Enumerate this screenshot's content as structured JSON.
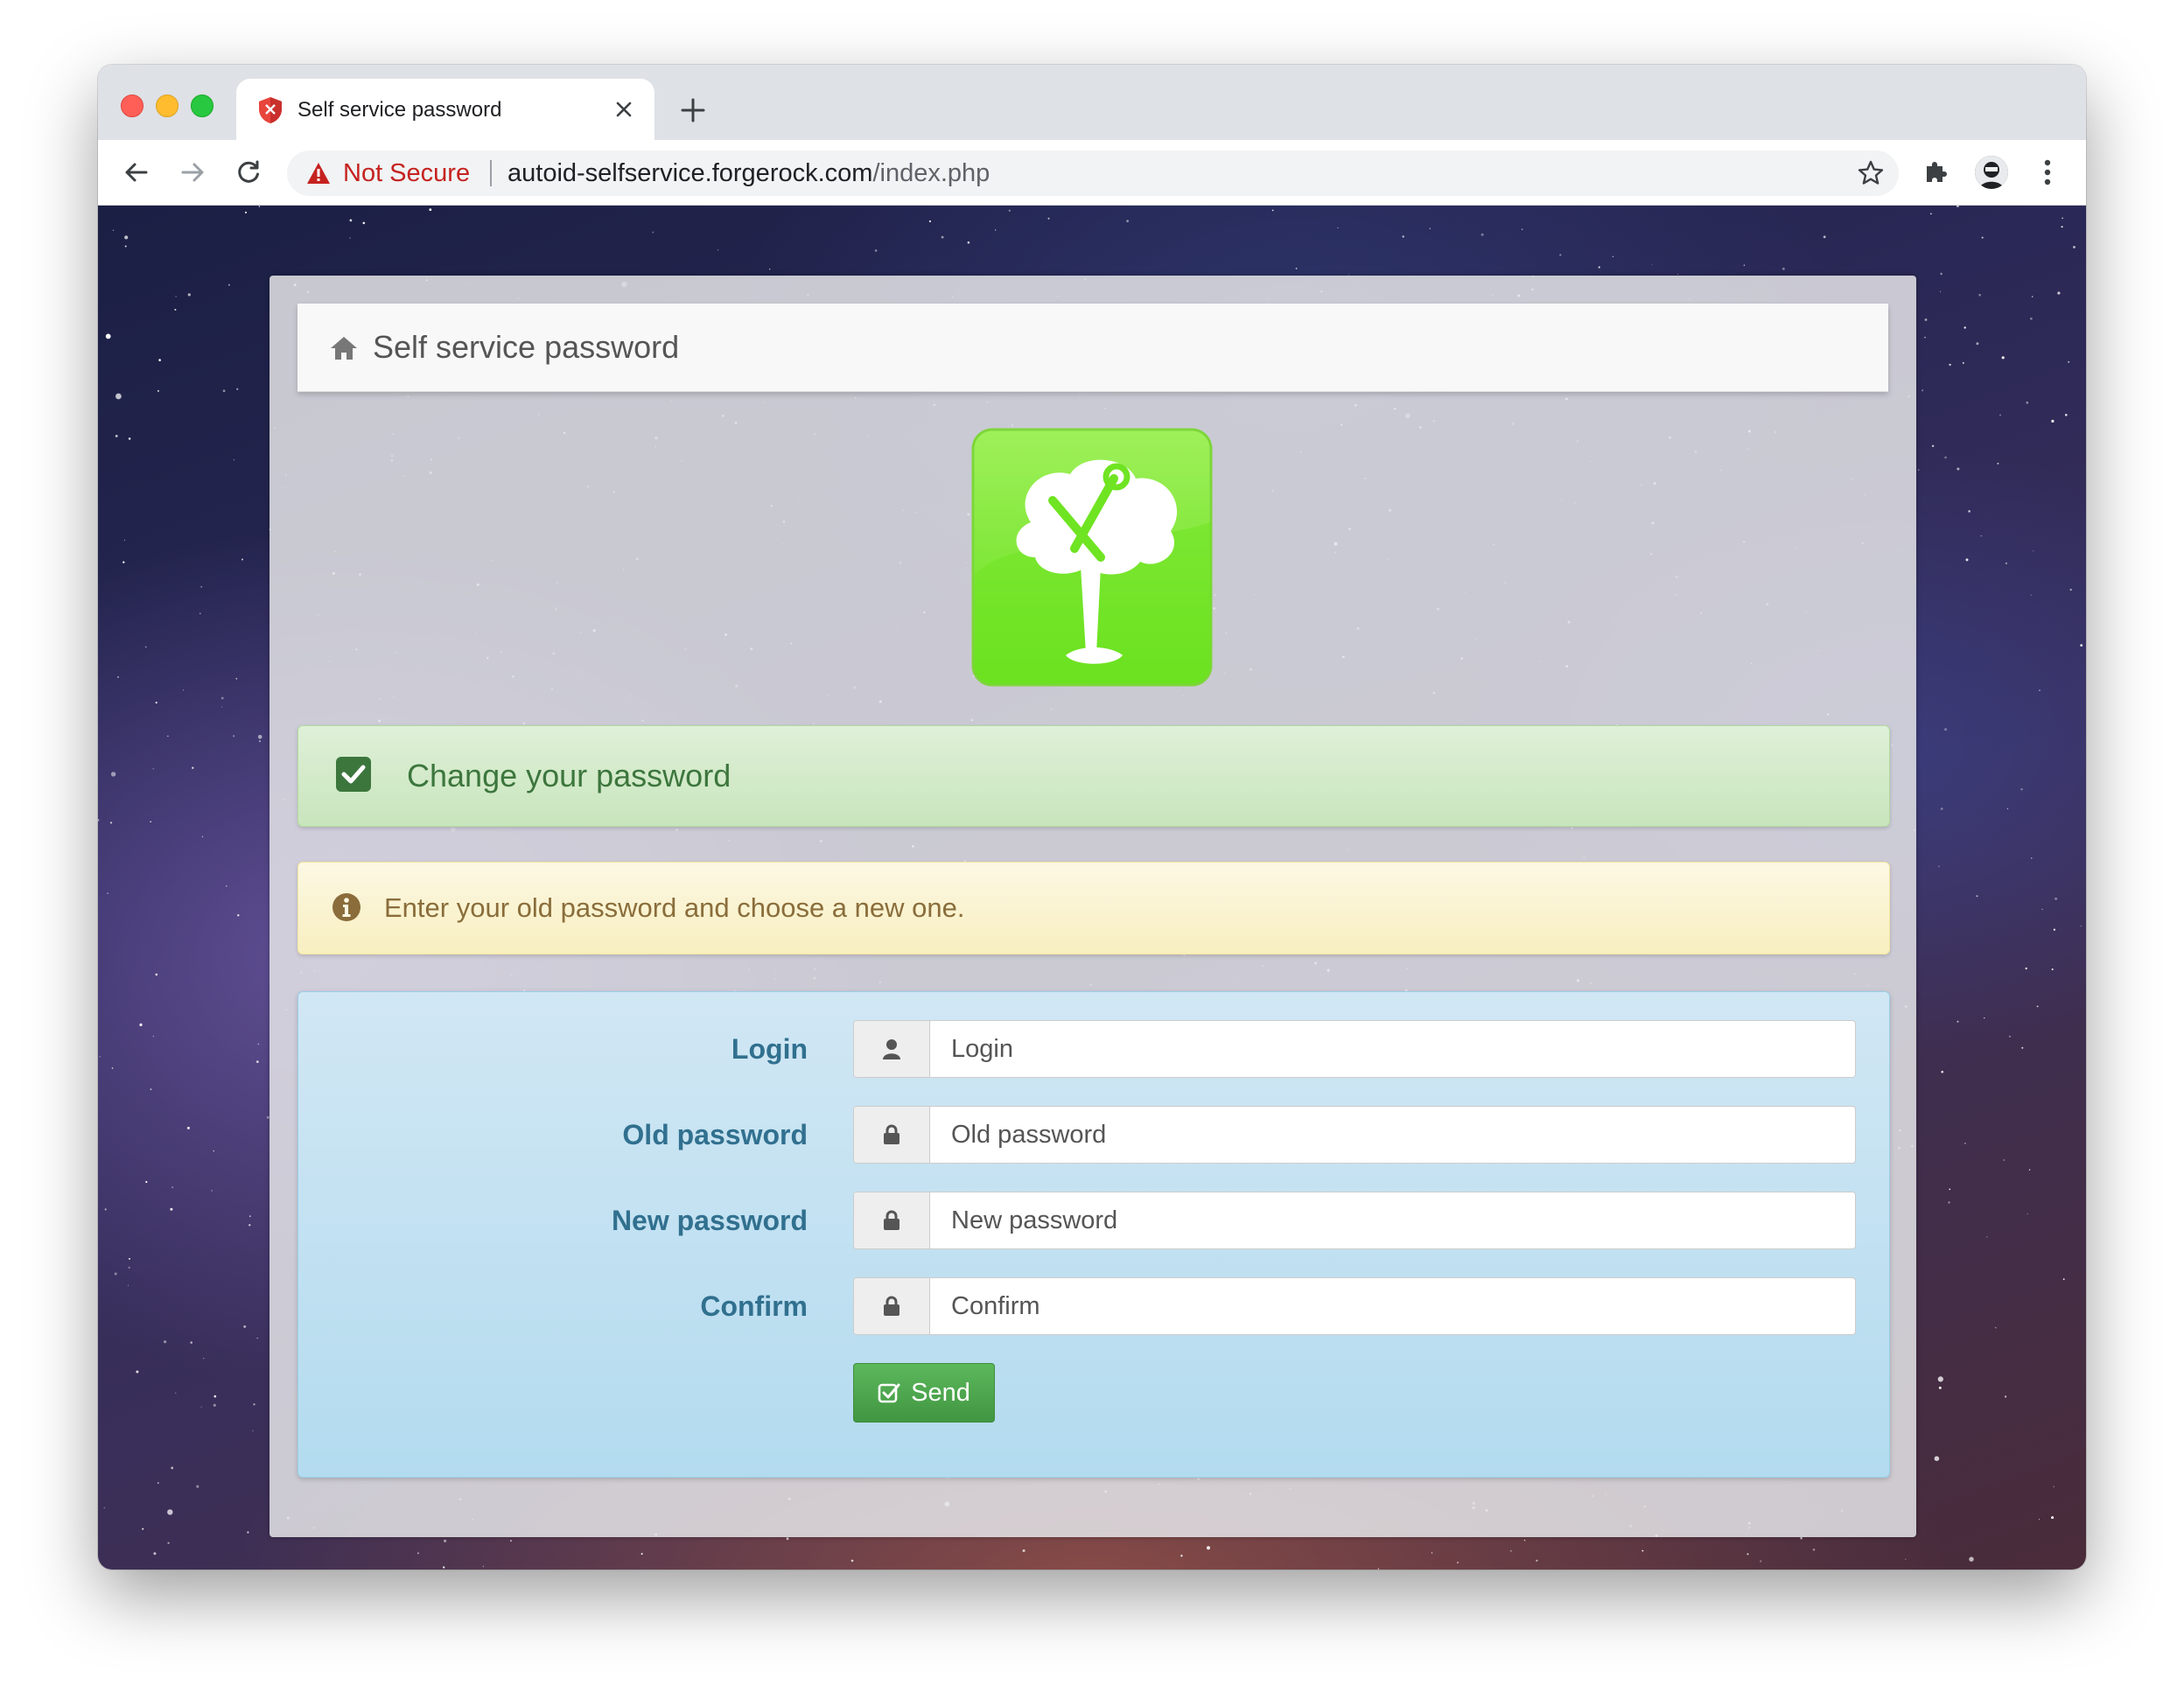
{
  "browser": {
    "tab_title": "Self service password",
    "address": {
      "security_label": "Not Secure",
      "host": "autoid-selfservice.forgerock.com",
      "path": "/index.php"
    }
  },
  "app": {
    "brand": "Self service password",
    "success_message": "Change your password",
    "info_message": "Enter your old password and choose a new one.",
    "form": {
      "fields": [
        {
          "label": "Login",
          "placeholder": "Login",
          "icon": "user-icon"
        },
        {
          "label": "Old password",
          "placeholder": "Old password",
          "icon": "lock-icon"
        },
        {
          "label": "New password",
          "placeholder": "New password",
          "icon": "lock-icon"
        },
        {
          "label": "Confirm",
          "placeholder": "Confirm",
          "icon": "lock-icon"
        }
      ],
      "submit_label": "Send"
    }
  },
  "colors": {
    "success_text": "#3c763d",
    "warning_text": "#8a6d3b",
    "info_label": "#31708f",
    "button_green": "#5cb85c",
    "insecure_red": "#c5221f"
  }
}
